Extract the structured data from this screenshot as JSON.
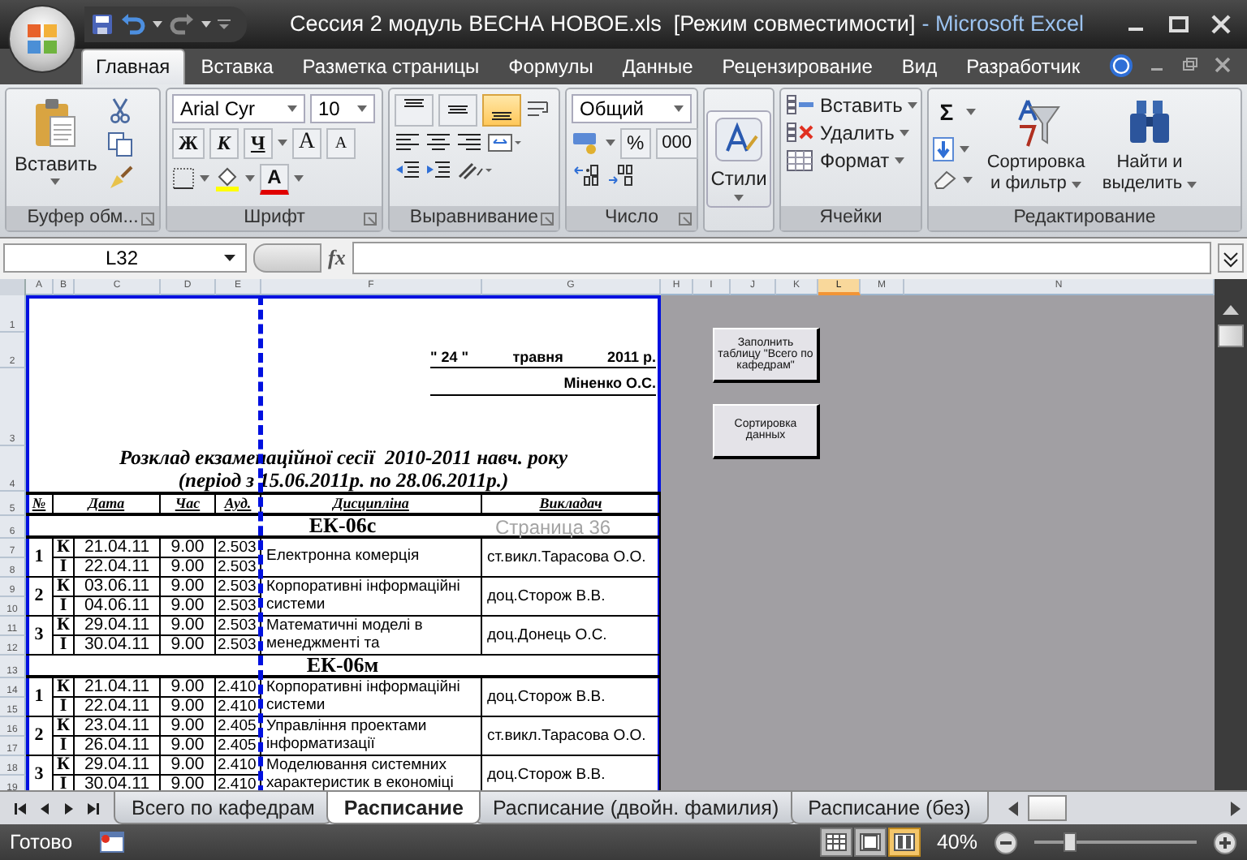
{
  "window": {
    "document_title": "Сессия 2 модуль ВЕСНА НОВОЕ.xls  [Режим совместимости]",
    "app_name": "- Microsoft Excel"
  },
  "tabs": [
    {
      "label": "Главная",
      "selected": true
    },
    {
      "label": "Вставка",
      "selected": false
    },
    {
      "label": "Разметка страницы",
      "selected": false
    },
    {
      "label": "Формулы",
      "selected": false
    },
    {
      "label": "Данные",
      "selected": false
    },
    {
      "label": "Рецензирование",
      "selected": false
    },
    {
      "label": "Вид",
      "selected": false
    },
    {
      "label": "Разработчик",
      "selected": false
    }
  ],
  "ribbon": {
    "clipboard": {
      "paste": "Вставить",
      "label": "Буфер обм..."
    },
    "font": {
      "name": "Arial Cyr",
      "size": "10",
      "bold": "Ж",
      "italic": "К",
      "underline": "Ч",
      "grow": "A",
      "shrink": "A",
      "font_color_glyph": "A",
      "label": "Шрифт"
    },
    "alignment": {
      "vertical": [
        {
          "selected": false
        },
        {
          "selected": false
        },
        {
          "selected": true
        }
      ],
      "label": "Выравнивание"
    },
    "number": {
      "format": "Общий",
      "percent": "%",
      "thousands": "000",
      "label": "Число"
    },
    "styles": {
      "label": "Стили"
    },
    "cells": {
      "insert": "Вставить",
      "delete": "Удалить",
      "format": "Формат",
      "label": "Ячейки"
    },
    "editing": {
      "sum": "Σ",
      "sort": "Сортировка и фильтр",
      "find": "Найти и выделить",
      "label": "Редактирование"
    }
  },
  "formula_bar": {
    "name_box": "L32",
    "fx": "fx"
  },
  "columns": [
    {
      "label": "A",
      "selected": false
    },
    {
      "label": "B",
      "selected": false
    },
    {
      "label": "C",
      "selected": false
    },
    {
      "label": "D",
      "selected": false
    },
    {
      "label": "E",
      "selected": false
    },
    {
      "label": "F",
      "selected": false
    },
    {
      "label": "G",
      "selected": false
    },
    {
      "label": "H",
      "selected": false
    },
    {
      "label": "I",
      "selected": false
    },
    {
      "label": "J",
      "selected": false
    },
    {
      "label": "K",
      "selected": false
    },
    {
      "label": "L",
      "selected": true
    },
    {
      "label": "M",
      "selected": false
    },
    {
      "label": "N",
      "selected": false
    }
  ],
  "rows": [
    "1",
    "2",
    "3",
    "4",
    "5",
    "6",
    "7",
    "8",
    "9",
    "10",
    "11",
    "12",
    "13",
    "14",
    "15",
    "16",
    "17",
    "18",
    "19"
  ],
  "sheet": {
    "date": {
      "day": "\" 24 \"",
      "month": "травня",
      "year": "2011 р."
    },
    "signer": "Міненко О.С.",
    "title": "Розклад екзаменаційної сесії  2010-2011 навч. року",
    "period": "(період з 15.06.2011р. по 28.06.2011р.)",
    "headers": [
      "№",
      "Дата",
      "Час",
      "Ауд.",
      "Дисципліна",
      "Викладач"
    ],
    "groups": [
      {
        "name": "ЕК-06с",
        "subjects": [
          {
            "number": "1",
            "sessions": [
              {
                "letter": "К",
                "date": "21.04.11",
                "time": "9.00",
                "room": "2.503"
              },
              {
                "letter": "І",
                "date": "22.04.11",
                "time": "9.00",
                "room": "2.503"
              }
            ],
            "discipline": "Електронна комерція",
            "teacher": "ст.викл.Тарасова О.О."
          },
          {
            "number": "2",
            "sessions": [
              {
                "letter": "К",
                "date": "03.06.11",
                "time": "9.00",
                "room": "2.503"
              },
              {
                "letter": "І",
                "date": "04.06.11",
                "time": "9.00",
                "room": "2.503"
              }
            ],
            "discipline": "Корпоративні інформаційні системи",
            "teacher": "доц.Сторож В.В."
          },
          {
            "number": "3",
            "sessions": [
              {
                "letter": "К",
                "date": "29.04.11",
                "time": "9.00",
                "room": "2.503"
              },
              {
                "letter": "І",
                "date": "30.04.11",
                "time": "9.00",
                "room": "2.503"
              }
            ],
            "discipline": "Математичні моделі в менеджменті та",
            "teacher": "доц.Донець О.С."
          }
        ]
      },
      {
        "name": "ЕК-06м",
        "subjects": [
          {
            "number": "1",
            "sessions": [
              {
                "letter": "К",
                "date": "21.04.11",
                "time": "9.00",
                "room": "2.410"
              },
              {
                "letter": "І",
                "date": "22.04.11",
                "time": "9.00",
                "room": "2.410"
              }
            ],
            "discipline": "Корпоративні інформаційні системи",
            "teacher": "доц.Сторож В.В."
          },
          {
            "number": "2",
            "sessions": [
              {
                "letter": "К",
                "date": "23.04.11",
                "time": "9.00",
                "room": "2.405"
              },
              {
                "letter": "І",
                "date": "26.04.11",
                "time": "9.00",
                "room": "2.405"
              }
            ],
            "discipline": "Управління проектами інформатизації",
            "teacher": "ст.викл.Тарасова О.О."
          },
          {
            "number": "3",
            "sessions": [
              {
                "letter": "К",
                "date": "29.04.11",
                "time": "9.00",
                "room": "2.410"
              },
              {
                "letter": "І",
                "date": "30.04.11",
                "time": "9.00",
                "room": "2.410"
              }
            ],
            "discipline": "Моделювання системних характеристик в економіці",
            "teacher": "доц.Сторож В.В."
          }
        ]
      }
    ],
    "page_label": "Страница 36"
  },
  "sheet_buttons": [
    "Заполнить таблицу \"Всего по кафедрам\"",
    "Сортировка данных"
  ],
  "sheet_tabs": [
    {
      "label": "Всего по кафедрам",
      "selected": false
    },
    {
      "label": "Расписание",
      "selected": true
    },
    {
      "label": "Расписание (двойн. фамилия)",
      "selected": false
    },
    {
      "label": "Расписание (без)",
      "selected": false
    }
  ],
  "status": {
    "ready": "Готово",
    "views": [
      {
        "kind": "normal",
        "selected": false
      },
      {
        "kind": "layout",
        "selected": false
      },
      {
        "kind": "break",
        "selected": true
      }
    ],
    "zoom": "40%",
    "level": 0.22
  }
}
